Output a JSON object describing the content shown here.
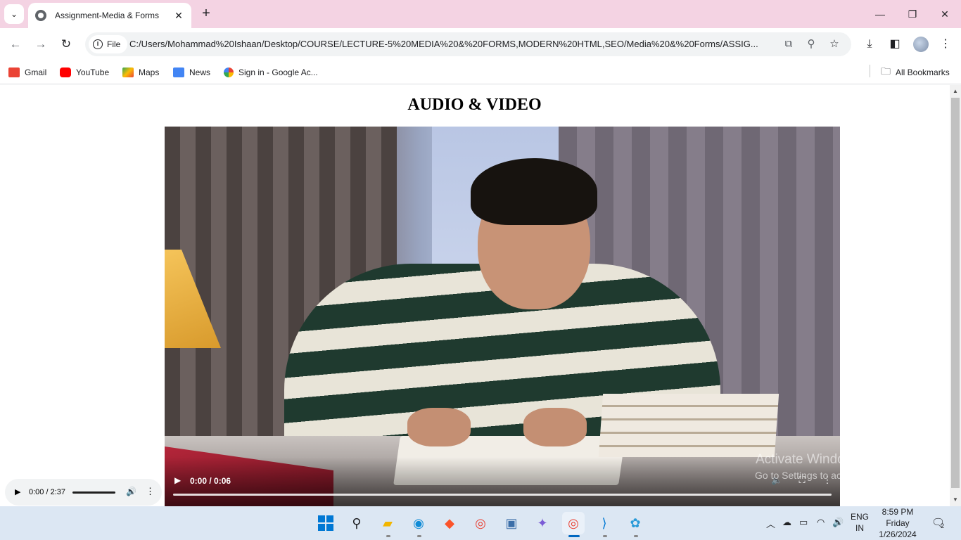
{
  "browser": {
    "tab": {
      "title": "Assignment-Media & Forms"
    },
    "url_chip": "File",
    "url": "C:/Users/Mohammad%20Ishaan/Desktop/COURSE/LECTURE-5%20MEDIA%20&%20FORMS,MODERN%20HTML,SEO/Media%20&%20Forms/ASSIG...",
    "bookmarks": [
      {
        "label": "Gmail",
        "icon": "gmail-icon",
        "color": "#ea4335"
      },
      {
        "label": "YouTube",
        "icon": "youtube-icon",
        "color": "#ff0000"
      },
      {
        "label": "Maps",
        "icon": "maps-icon",
        "color": "#34a853"
      },
      {
        "label": "News",
        "icon": "news-icon",
        "color": "#4285f4"
      },
      {
        "label": "Sign in - Google Ac...",
        "icon": "google-icon",
        "color": "#4285f4"
      }
    ],
    "all_bookmarks": "All Bookmarks"
  },
  "page": {
    "title": "AUDIO & VIDEO",
    "video": {
      "time": "0:00 / 0:06",
      "progress": 0
    },
    "audio": {
      "time": "0:00 / 2:37",
      "progress": 0
    }
  },
  "watermark": {
    "line1": "Activate Windows",
    "line2": "Go to Settings to activate Windows."
  },
  "taskbar": {
    "lang": "ENG",
    "region": "IN",
    "time": "8:59 PM",
    "day": "Friday",
    "date": "1/26/2024",
    "notifications": "2"
  }
}
